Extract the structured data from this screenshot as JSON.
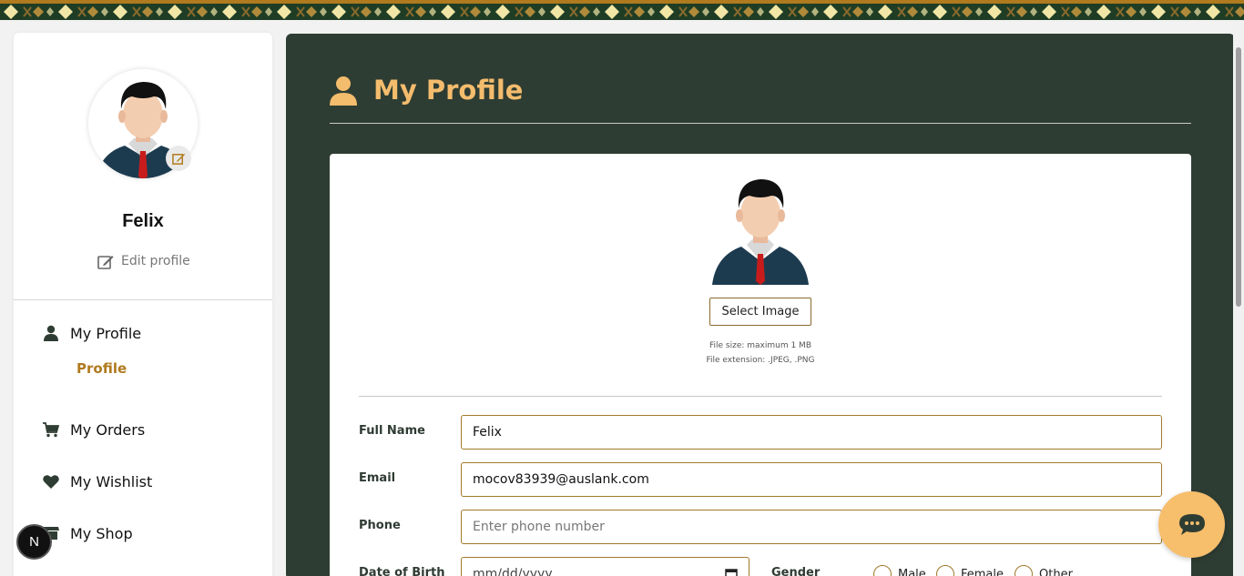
{
  "sidebar": {
    "user_name": "Felix",
    "edit_profile_label": "Edit profile",
    "nav": {
      "my_profile": "My Profile",
      "profile_sub": "Profile",
      "my_orders": "My Orders",
      "my_wishlist": "My Wishlist",
      "my_shop": "My Shop"
    }
  },
  "badge": {
    "letter": "N"
  },
  "main": {
    "title": "My Profile",
    "select_image_label": "Select Image",
    "file_size_note": "File size: maximum 1 MB",
    "file_ext_note": "File extension: .JPEG, .PNG",
    "form": {
      "full_name_label": "Full Name",
      "full_name_value": "Felix",
      "email_label": "Email",
      "email_value": "mocov83939@auslank.com",
      "phone_label": "Phone",
      "phone_placeholder": "Enter phone number",
      "dob_label": "Date of Birth",
      "dob_placeholder": "mm/dd/yyyy",
      "gender_label": "Gender",
      "gender_options": [
        "Male",
        "Female",
        "Other"
      ]
    }
  },
  "colors": {
    "accent": "#f4bc6d",
    "panel": "#2e3d33",
    "brown": "#b07a1e",
    "dark_green": "#1f3d25"
  },
  "icons": {
    "edit": "edit-icon",
    "user": "user-icon",
    "cart": "cart-icon",
    "heart": "heart-icon",
    "shop": "shop-icon",
    "calendar": "calendar-icon",
    "chat": "chat-icon"
  }
}
